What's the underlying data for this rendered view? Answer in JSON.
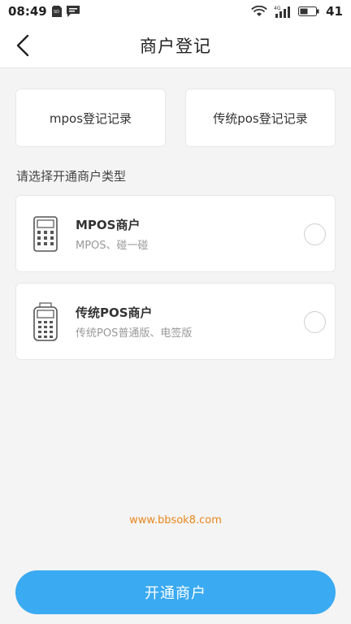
{
  "status_bar": {
    "time": "08:49",
    "battery": "41",
    "network": "4G",
    "icons": [
      "sd-card-icon",
      "message-icon",
      "wifi-icon",
      "signal-icon",
      "battery-icon"
    ]
  },
  "header": {
    "title": "商户登记",
    "back_icon": "back-arrow-icon"
  },
  "records": [
    {
      "label": "mpos登记记录"
    },
    {
      "label": "传统pos登记记录"
    }
  ],
  "section": {
    "label": "请选择开通商户类型"
  },
  "merchant_types": [
    {
      "title": "MPOS商户",
      "description": "MPOS、碰一碰",
      "icon": "calculator-icon",
      "selected": false
    },
    {
      "title": "传统POS商户",
      "description": "传统POS普通版、电签版",
      "icon": "pos-terminal-icon",
      "selected": false
    }
  ],
  "watermark": "www.bbsok8.com",
  "primary_button": {
    "label": "开通商户"
  },
  "colors": {
    "accent": "#3aaaf2",
    "watermark": "#e8871e",
    "background": "#f4f4f4"
  }
}
